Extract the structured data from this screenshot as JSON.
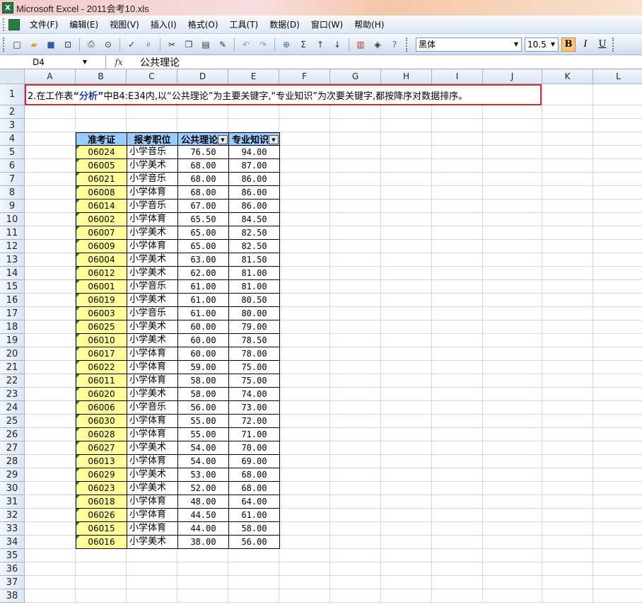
{
  "window": {
    "title": "Microsoft Excel - 2011会考10.xls",
    "app_icon": "excel-icon"
  },
  "menu": [
    "文件(F)",
    "编辑(E)",
    "视图(V)",
    "插入(I)",
    "格式(O)",
    "工具(T)",
    "数据(D)",
    "窗口(W)",
    "帮助(H)"
  ],
  "toolbar": {
    "font": "黑体",
    "size": "10.5",
    "bold": "B",
    "italic": "I",
    "underline": "U"
  },
  "formula_bar": {
    "name_box": "D4",
    "fx": "fx",
    "content": "公共理论"
  },
  "columns": [
    "A",
    "B",
    "C",
    "D",
    "E",
    "F",
    "G",
    "H",
    "I",
    "J",
    "K",
    "L"
  ],
  "instruction": {
    "prefix": "2.在工作表 ",
    "sheet": "“分析”",
    "suffix": " 中B4:E34内,以“公共理论”为主要关键字,“专业知识”为次要关键字,都按降序对数据排序。"
  },
  "table_headers": [
    "准考证",
    "报考职位",
    "公共理论",
    "专业知识"
  ],
  "table_rows": [
    [
      "06024",
      "小学音乐",
      "76.50",
      "94.00"
    ],
    [
      "06005",
      "小学美术",
      "68.00",
      "87.00"
    ],
    [
      "06021",
      "小学音乐",
      "68.00",
      "86.00"
    ],
    [
      "06008",
      "小学体育",
      "68.00",
      "86.00"
    ],
    [
      "06014",
      "小学音乐",
      "67.00",
      "86.00"
    ],
    [
      "06002",
      "小学体育",
      "65.50",
      "84.50"
    ],
    [
      "06007",
      "小学美术",
      "65.00",
      "82.50"
    ],
    [
      "06009",
      "小学体育",
      "65.00",
      "82.50"
    ],
    [
      "06004",
      "小学美术",
      "63.00",
      "81.50"
    ],
    [
      "06012",
      "小学美术",
      "62.00",
      "81.00"
    ],
    [
      "06001",
      "小学音乐",
      "61.00",
      "81.00"
    ],
    [
      "06019",
      "小学美术",
      "61.00",
      "80.50"
    ],
    [
      "06003",
      "小学音乐",
      "61.00",
      "80.00"
    ],
    [
      "06025",
      "小学美术",
      "60.00",
      "79.00"
    ],
    [
      "06010",
      "小学美术",
      "60.00",
      "78.50"
    ],
    [
      "06017",
      "小学体育",
      "60.00",
      "78.00"
    ],
    [
      "06022",
      "小学体育",
      "59.00",
      "75.00"
    ],
    [
      "06011",
      "小学体育",
      "58.00",
      "75.00"
    ],
    [
      "06020",
      "小学美术",
      "58.00",
      "74.00"
    ],
    [
      "06006",
      "小学音乐",
      "56.00",
      "73.00"
    ],
    [
      "06030",
      "小学体育",
      "55.00",
      "72.00"
    ],
    [
      "06028",
      "小学体育",
      "55.00",
      "71.00"
    ],
    [
      "06027",
      "小学美术",
      "54.00",
      "70.00"
    ],
    [
      "06013",
      "小学体育",
      "54.00",
      "69.00"
    ],
    [
      "06029",
      "小学美术",
      "53.00",
      "68.00"
    ],
    [
      "06023",
      "小学美术",
      "52.00",
      "68.00"
    ],
    [
      "06018",
      "小学体育",
      "48.00",
      "64.00"
    ],
    [
      "06026",
      "小学体育",
      "44.50",
      "61.00"
    ],
    [
      "06015",
      "小学体育",
      "44.00",
      "58.00"
    ],
    [
      "06016",
      "小学美术",
      "38.00",
      "56.00"
    ]
  ],
  "row_numbers": [
    "1",
    "2",
    "3",
    "4",
    "5",
    "6",
    "7",
    "8",
    "9",
    "10",
    "11",
    "12",
    "13",
    "14",
    "15",
    "16",
    "17",
    "18",
    "19",
    "20",
    "21",
    "22",
    "23",
    "24",
    "25",
    "26",
    "27",
    "28",
    "29",
    "30",
    "31",
    "32",
    "33",
    "34",
    "35",
    "36",
    "37",
    "38"
  ]
}
